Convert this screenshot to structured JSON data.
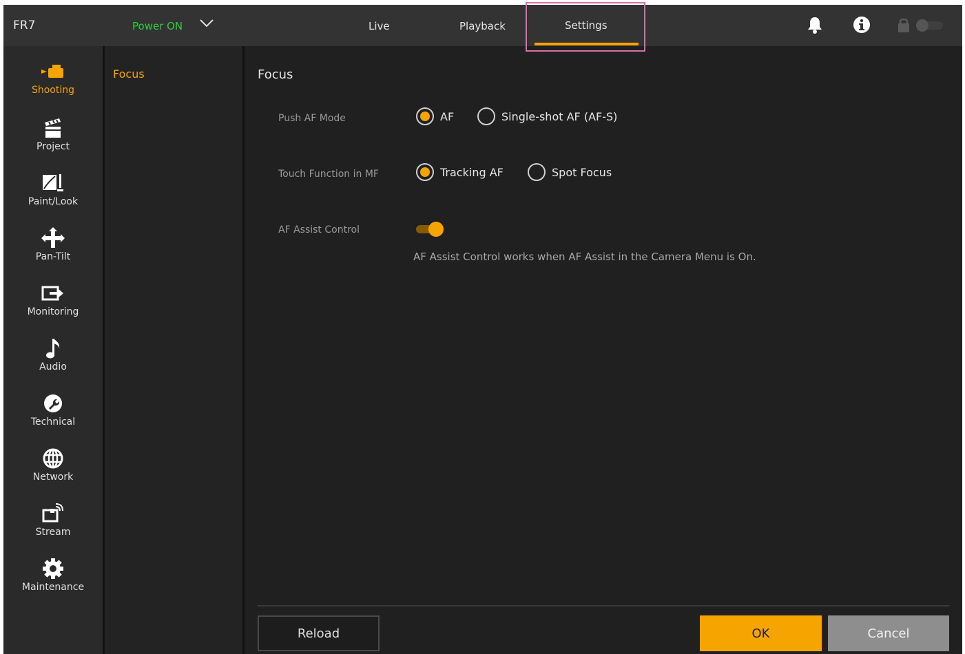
{
  "topbar": {
    "model": "FR7",
    "power_status": "Power ON",
    "tabs": [
      {
        "label": "Live",
        "active": false
      },
      {
        "label": "Playback",
        "active": false
      },
      {
        "label": "Settings",
        "active": true
      }
    ],
    "icons": [
      "bell-icon",
      "info-icon",
      "lock-icon",
      "toggle-icon"
    ]
  },
  "leftnav": {
    "items": [
      {
        "label": "Shooting",
        "icon": "camera-icon",
        "active": true
      },
      {
        "label": "Project",
        "icon": "clapperboard-icon",
        "active": false
      },
      {
        "label": "Paint/Look",
        "icon": "paint-icon",
        "active": false
      },
      {
        "label": "Pan-Tilt",
        "icon": "pan-tilt-icon",
        "active": false
      },
      {
        "label": "Monitoring",
        "icon": "monitor-output-icon",
        "active": false
      },
      {
        "label": "Audio",
        "icon": "music-note-icon",
        "active": false
      },
      {
        "label": "Technical",
        "icon": "wrench-icon",
        "active": false
      },
      {
        "label": "Network",
        "icon": "globe-icon",
        "active": false
      },
      {
        "label": "Stream",
        "icon": "stream-icon",
        "active": false
      },
      {
        "label": "Maintenance",
        "icon": "gear-icon",
        "active": false
      }
    ]
  },
  "subnav": {
    "items": [
      {
        "label": "Focus",
        "active": true
      }
    ]
  },
  "content": {
    "title": "Focus",
    "push_af_mode": {
      "label": "Push AF Mode",
      "options": [
        {
          "label": "AF",
          "selected": true
        },
        {
          "label": "Single-shot AF (AF-S)",
          "selected": false
        }
      ]
    },
    "touch_function": {
      "label": "Touch Function in MF",
      "options": [
        {
          "label": "Tracking AF",
          "selected": true
        },
        {
          "label": "Spot Focus",
          "selected": false
        }
      ]
    },
    "af_assist": {
      "label": "AF Assist Control",
      "enabled": true,
      "note": "AF Assist Control works when AF Assist in the Camera Menu is On."
    }
  },
  "footer": {
    "reload_label": "Reload",
    "ok_label": "OK",
    "cancel_label": "Cancel"
  },
  "colors": {
    "accent": "#f5a400",
    "power_on": "#2ecc40",
    "highlight_box": "#d76fa8"
  }
}
